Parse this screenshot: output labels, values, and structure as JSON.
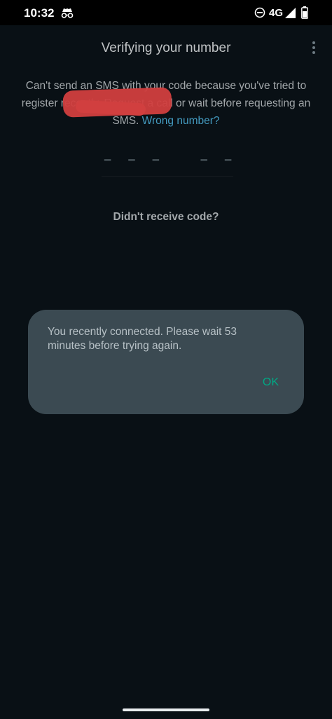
{
  "status_bar": {
    "time": "10:32",
    "network": "4G",
    "icons": [
      "incognito-icon",
      "do-not-disturb-icon",
      "signal-icon",
      "battery-icon"
    ]
  },
  "header": {
    "title": "Verifying your number",
    "menu_icon": "more-vertical-icon"
  },
  "explanation": {
    "text": "Can't send an SMS with your code because you've tried to register recently. Request a call or wait before requesting an SMS.",
    "link": "Wrong number?"
  },
  "code_input": {
    "placeholder": "– – –   – – –",
    "value": ""
  },
  "resend": {
    "label": "Didn't receive code?"
  },
  "dialog": {
    "message": "You recently connected. Please wait 53 minutes before trying again.",
    "ok_label": "OK"
  },
  "colors": {
    "background": "#0b141a",
    "dialog": "#3b4a52",
    "accent": "#00a884",
    "link": "#53bdeb",
    "redaction": "#ff4d4d"
  }
}
